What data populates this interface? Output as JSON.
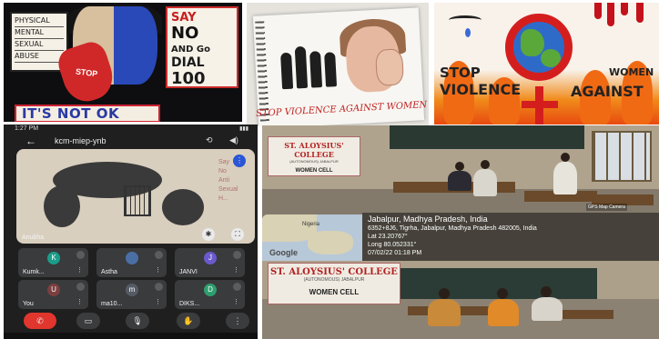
{
  "poster1": {
    "labels": [
      "PHYSICAL",
      "MENTAL",
      "SEXUAL",
      "ABUSE"
    ],
    "hand_text": "STOP",
    "say_no": [
      "SAY",
      "NO",
      "AND Go",
      "DIAL",
      "100"
    ],
    "banner": "IT'S NOT OK"
  },
  "poster2": {
    "caption": "STOP VIOLENCE AGAINST WOMEN"
  },
  "poster3": {
    "stop": "STOP",
    "violence": "VIOLENCE",
    "women": "WOMEN",
    "against": "AGAINST"
  },
  "phone": {
    "status_time": "1:27 PM",
    "meeting_code": "kcm-miep-ynb",
    "presenter_name": "Anubha",
    "slide_side_text": [
      "Say",
      "No",
      "Anti",
      "Sexual",
      "H..."
    ],
    "participants": [
      {
        "initial": "K",
        "name": "Kumk...",
        "color": "#1a9e8a"
      },
      {
        "initial": "",
        "name": "Astha",
        "color": "#4a6fa5"
      },
      {
        "initial": "J",
        "name": "JANVI",
        "color": "#6a5acd"
      },
      {
        "initial": "U",
        "name": "You",
        "color": "#7b3f3f"
      },
      {
        "initial": "m",
        "name": "ma10...",
        "color": "#555b66"
      },
      {
        "initial": "D",
        "name": "DIKS...",
        "color": "#2e9e6e"
      }
    ]
  },
  "room1": {
    "banner_college": "ST. ALOYSIUS' COLLEGE",
    "banner_sub": "(AUTONOMOUS) JABALPUR",
    "banner_cell": "WOMEN CELL",
    "map_label": "Nigeria",
    "map_logo": "Google",
    "gps_title": "Jabalpur, Madhya Pradesh, India",
    "gps_address": "6352+8J6, Tigrha, Jabalpur, Madhya Pradesh 482005, India",
    "gps_lat": "Lat 23.20767°",
    "gps_long": "Long 80.052331°",
    "gps_datetime": "07/02/22 01:18 PM",
    "gps_camera": "GPS Map Camera"
  },
  "room2": {
    "banner_college": "ST. ALOYSIUS' COLLEGE",
    "banner_sub": "(AUTONOMOUS) JABALPUR",
    "banner_cell": "WOMEN CELL"
  }
}
